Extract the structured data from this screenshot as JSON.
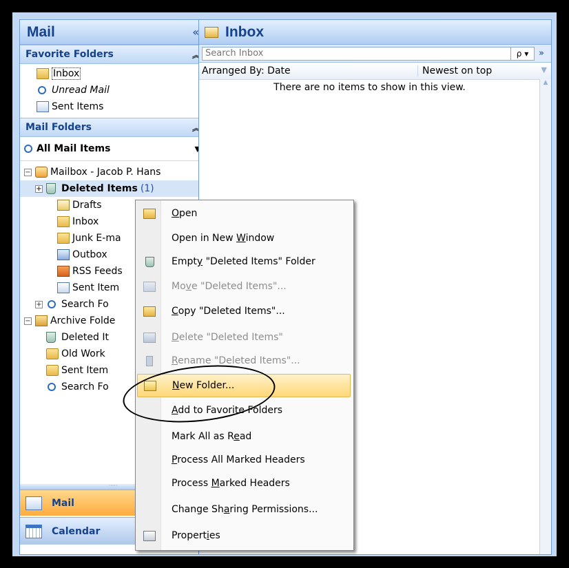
{
  "nav": {
    "title": "Mail",
    "collapse": "«",
    "favorites": {
      "header": "Favorite Folders",
      "items": [
        "Inbox",
        "Unread Mail",
        "Sent Items"
      ]
    },
    "mail_folders": {
      "header": "Mail Folders",
      "all_items": "All Mail Items",
      "tree": {
        "mailbox": "Mailbox - Jacob P. Hans",
        "deleted": "Deleted Items",
        "deleted_count": "(1)",
        "children": [
          "Drafts",
          "Inbox",
          "Junk E-ma",
          "Outbox",
          "RSS Feeds",
          "Sent Item",
          "Search Fo"
        ],
        "archive": "Archive Folde",
        "archive_children": [
          "Deleted It",
          "Old Work",
          "Sent Item",
          "Search Fo"
        ]
      }
    },
    "buttons": {
      "mail": "Mail",
      "calendar": "Calendar"
    },
    "splitter": "·····"
  },
  "inbox": {
    "title": "Inbox",
    "search_placeholder": "Search Inbox",
    "search_icon": "ρ ▾",
    "expand": "»",
    "arranged_by": "Arranged By: Date",
    "sort": "Newest on top",
    "empty_message": "There are no items to show in this view."
  },
  "context_menu": {
    "items": [
      {
        "pre": "",
        "u": "O",
        "post": "pen",
        "disabled": false
      },
      {
        "pre": "Open in New ",
        "u": "W",
        "post": "indow",
        "disabled": false
      },
      {
        "pre": "Empt",
        "u": "y",
        "post": " \"Deleted Items\" Folder",
        "disabled": false
      },
      {
        "pre": "Mo",
        "u": "v",
        "post": "e \"Deleted Items\"...",
        "disabled": true
      },
      {
        "pre": "",
        "u": "C",
        "post": "opy \"Deleted Items\"...",
        "disabled": false
      },
      {
        "pre": "",
        "u": "D",
        "post": "elete \"Deleted Items\"",
        "disabled": true
      },
      {
        "pre": "",
        "u": "R",
        "post": "ename \"Deleted Items\"...",
        "disabled": true
      },
      {
        "pre": "",
        "u": "N",
        "post": "ew Folder...",
        "disabled": false
      },
      {
        "pre": "",
        "u": "A",
        "post": "dd to Favorite Folders",
        "disabled": false
      },
      {
        "pre": "Mark All as R",
        "u": "e",
        "post": "ad",
        "disabled": false
      },
      {
        "pre": "",
        "u": "P",
        "post": "rocess All Marked Headers",
        "disabled": false
      },
      {
        "pre": "Process ",
        "u": "M",
        "post": "arked Headers",
        "disabled": false
      },
      {
        "pre": "Change Sh",
        "u": "a",
        "post": "ring Permissions...",
        "disabled": false
      },
      {
        "pre": "Propert",
        "u": "i",
        "post": "es",
        "disabled": false
      }
    ]
  }
}
